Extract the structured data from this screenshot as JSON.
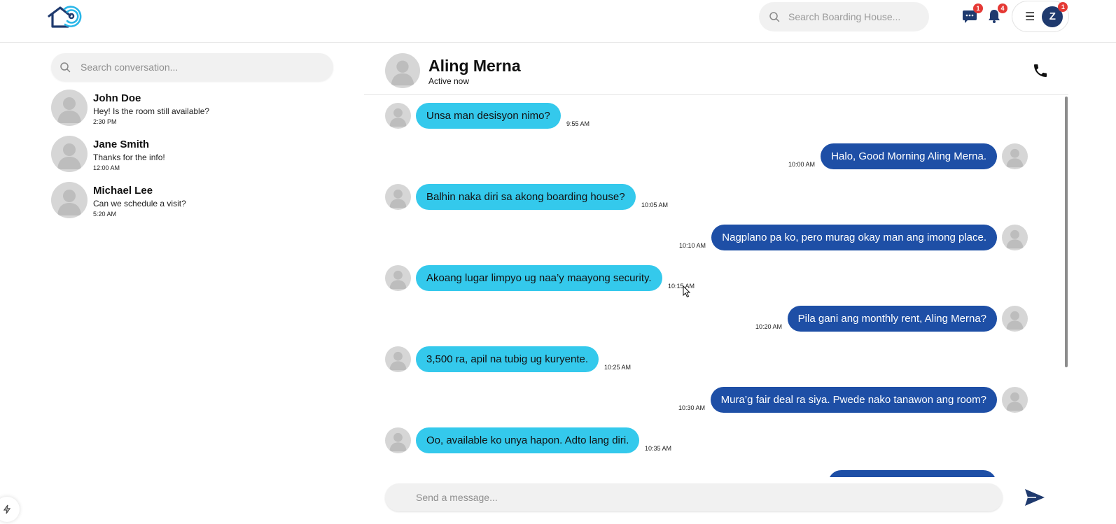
{
  "header": {
    "logo_icon": "house-signal-icon",
    "search": {
      "placeholder": "Search Boarding House...",
      "icon": "search-icon"
    },
    "messages_badge": "1",
    "notifications_badge": "4",
    "menu_icon": "hamburger-icon",
    "user_initial": "Z",
    "user_badge": "1"
  },
  "sidebar": {
    "search": {
      "placeholder": "Search conversation..."
    },
    "conversations": [
      {
        "name": "John Doe",
        "last_message": "Hey! Is the room still available?",
        "time": "2:30 PM"
      },
      {
        "name": "Jane Smith",
        "last_message": "Thanks for the info!",
        "time": "12:00 AM"
      },
      {
        "name": "Michael Lee",
        "last_message": "Can we schedule a visit?",
        "time": "5:20 AM"
      }
    ]
  },
  "chat": {
    "name": "Aling Merna",
    "status": "Active now",
    "messages": [
      {
        "side": "in",
        "text": "Unsa man desisyon nimo?",
        "time": "9:55 AM"
      },
      {
        "side": "out",
        "text": "Halo, Good Morning Aling Merna.",
        "time": "10:00 AM"
      },
      {
        "side": "in",
        "text": "Balhin naka diri sa akong boarding house?",
        "time": "10:05 AM"
      },
      {
        "side": "out",
        "text": "Nagplano pa ko, pero murag okay man ang imong place.",
        "time": "10:10 AM"
      },
      {
        "side": "in",
        "text": "Akoang lugar limpyo ug naa’y maayong security.",
        "time": "10:15 AM"
      },
      {
        "side": "out",
        "text": "Pila gani ang monthly rent, Aling Merna?",
        "time": "10:20 AM"
      },
      {
        "side": "in",
        "text": "3,500 ra, apil na tubig ug kuryente.",
        "time": "10:25 AM"
      },
      {
        "side": "out",
        "text": "Mura’g fair deal ra siya. Pwede nako tanawon ang room?",
        "time": "10:30 AM"
      },
      {
        "side": "in",
        "text": "Oo, available ko unya hapon. Adto lang diri.",
        "time": "10:35 AM"
      }
    ],
    "input": {
      "placeholder": "Send a message..."
    }
  },
  "colors": {
    "incoming_bubble": "#34c9ec",
    "outgoing_bubble": "#1e4fa6",
    "badge": "#e53935",
    "brand": "#1f3a6e"
  }
}
